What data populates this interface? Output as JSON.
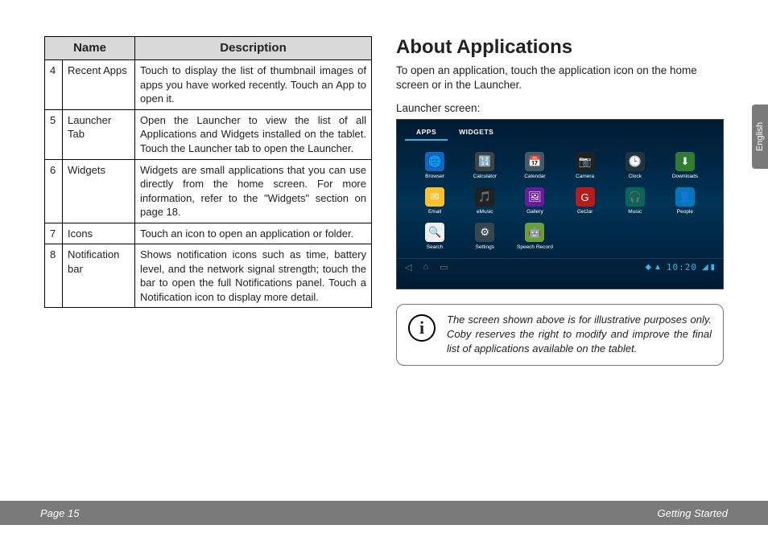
{
  "sideTab": "English",
  "table": {
    "headers": {
      "name": "Name",
      "desc": "Description"
    },
    "rows": [
      {
        "num": "4",
        "name": "Recent Apps",
        "desc": "Touch to display the list of thumbnail images of apps you have worked recently. Touch an App to open it."
      },
      {
        "num": "5",
        "name": "Launcher Tab",
        "desc": "Open the Launcher to view the list of all Applications and Widgets installed on the tablet. Touch the Launcher tab to open the Launcher."
      },
      {
        "num": "6",
        "name": "Widgets",
        "desc": "Widgets are small applications that you can use directly from the home screen. For more information, refer to the \"Widgets\" section on page 18."
      },
      {
        "num": "7",
        "name": "Icons",
        "desc": "Touch an icon to open an application or folder."
      },
      {
        "num": "8",
        "name": "Notification bar",
        "desc": "Shows notification icons such as time, battery level, and the network signal strength; touch the bar to open the full Notifications panel. Touch a Notification icon to display more detail."
      }
    ]
  },
  "section": {
    "title": "About Applications",
    "intro": "To open an application, touch the application icon on the home screen or in the Launcher.",
    "screenLabel": "Launcher screen:"
  },
  "launcher": {
    "tabs": {
      "apps": "APPS",
      "widgets": "WIDGETS"
    },
    "apps": [
      {
        "label": "Browser",
        "bg": "#1565c0",
        "glyph": "🌐"
      },
      {
        "label": "Calculator",
        "bg": "#424242",
        "glyph": "🔢"
      },
      {
        "label": "Calendar",
        "bg": "#455a64",
        "glyph": "📅"
      },
      {
        "label": "Camera",
        "bg": "#212121",
        "glyph": "📷"
      },
      {
        "label": "Clock",
        "bg": "#263238",
        "glyph": "🕒"
      },
      {
        "label": "Downloads",
        "bg": "#2e7d32",
        "glyph": "⬇"
      },
      {
        "label": "Email",
        "bg": "#fbc02d",
        "glyph": "✉"
      },
      {
        "label": "eMusic",
        "bg": "#212121",
        "glyph": "🎵"
      },
      {
        "label": "Gallery",
        "bg": "#6a1b9a",
        "glyph": "🖼"
      },
      {
        "label": "GetJar",
        "bg": "#b71c1c",
        "glyph": "G"
      },
      {
        "label": "Music",
        "bg": "#00695c",
        "glyph": "🎧"
      },
      {
        "label": "People",
        "bg": "#0277bd",
        "glyph": "👤"
      },
      {
        "label": "Search",
        "bg": "#eeeeee",
        "glyph": "🔍"
      },
      {
        "label": "Settings",
        "bg": "#37474f",
        "glyph": "⚙"
      },
      {
        "label": "Speech Record",
        "bg": "#689f38",
        "glyph": "🤖"
      }
    ],
    "clock": "10:20"
  },
  "note": {
    "text": "The screen shown above is for illustrative purposes only. Coby reserves the right to modify and improve the final list of applications available on the tablet."
  },
  "footer": {
    "left": "Page 15",
    "right": "Getting Started"
  }
}
